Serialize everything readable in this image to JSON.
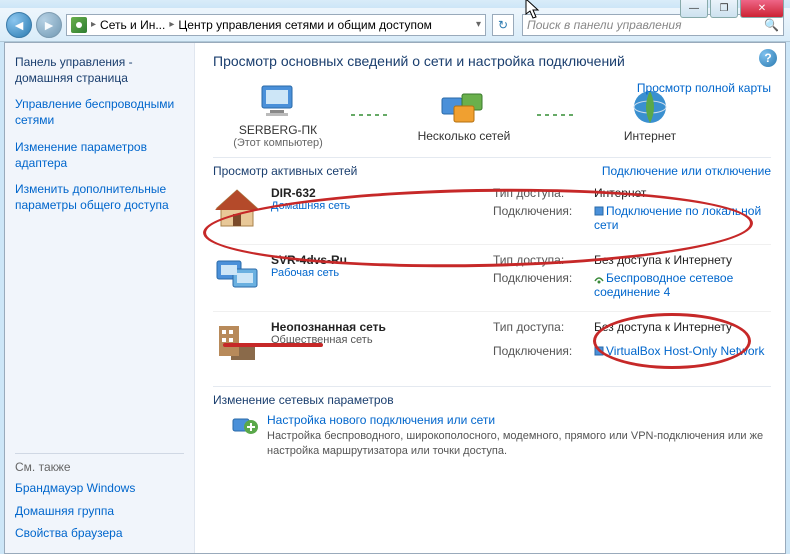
{
  "window": {
    "minimize": "—",
    "maximize": "❐",
    "close": "✕"
  },
  "breadcrumb": {
    "item1": "Сеть и Ин...",
    "item2": "Центр управления сетями и общим доступом"
  },
  "search": {
    "placeholder": "Поиск в панели управления"
  },
  "sidebar": {
    "heading": "Панель управления - домашняя страница",
    "links": {
      "wireless": "Управление беспроводными сетями",
      "adapter": "Изменение параметров адаптера",
      "sharing": "Изменить дополнительные параметры общего доступа"
    },
    "see_also": "См. также",
    "bottom": {
      "firewall": "Брандмауэр Windows",
      "homegroup": "Домашняя группа",
      "browser": "Свойства браузера"
    }
  },
  "main": {
    "title": "Просмотр основных сведений о сети и настройка подключений",
    "map_link": "Просмотр полной карты",
    "overview": {
      "pc_name": "SERBERG-ПК",
      "pc_sub": "(Этот компьютер)",
      "mid": "Несколько сетей",
      "internet": "Интернет"
    },
    "active_label": "Просмотр активных сетей",
    "active_link": "Подключение или отключение",
    "labels": {
      "access": "Тип доступа:",
      "conn": "Подключения:"
    },
    "networks": [
      {
        "name": "DIR-632",
        "type": "Домашняя сеть",
        "access": "Интернет",
        "conn": "Подключение по локальной сети"
      },
      {
        "name": "SVR-4dvs-Ru",
        "type": "Рабочая сеть",
        "access": "Без доступа к Интернету",
        "conn": "Беспроводное сетевое соединение 4"
      },
      {
        "name": "Неопознанная сеть",
        "type": "Общественная сеть",
        "access": "Без доступа к Интернету",
        "conn": "VirtualBox Host-Only Network"
      }
    ],
    "change": {
      "heading": "Изменение сетевых параметров",
      "item_title": "Настройка нового подключения или сети",
      "item_desc": "Настройка беспроводного, широкополосного, модемного, прямого или VPN-подключения или же настройка маршрутизатора или точки доступа."
    }
  }
}
